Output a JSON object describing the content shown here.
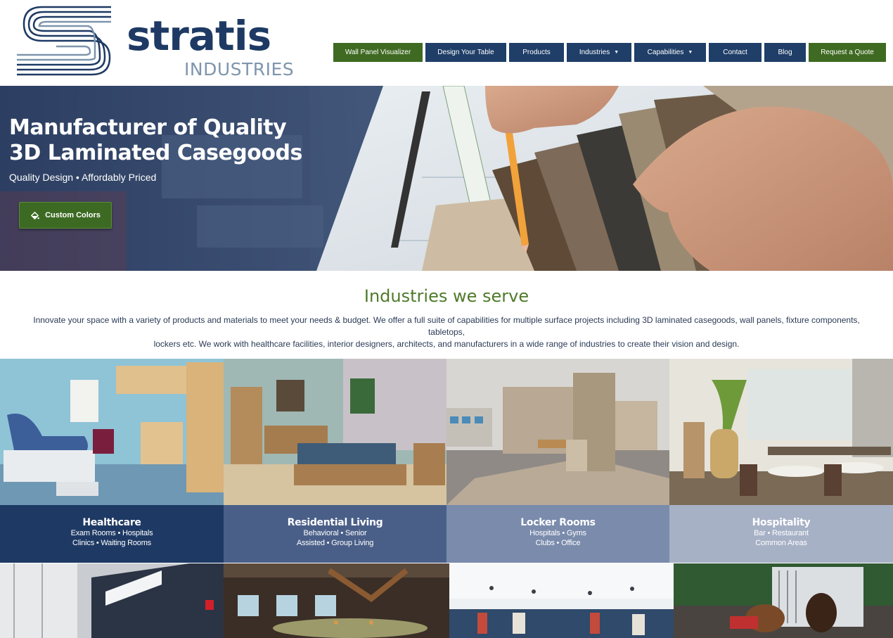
{
  "logo": {
    "word": "stratis",
    "sub": "INDUSTRIES"
  },
  "nav": [
    {
      "label": "Wall Panel Visualizer",
      "name": "nav-wall-panel-visualizer",
      "color": "#3f6a22"
    },
    {
      "label": "Design Your Table",
      "name": "nav-design-your-table",
      "color": "#1f3e68"
    },
    {
      "label": "Products",
      "name": "nav-products",
      "color": "#1f3e68"
    },
    {
      "label": "Industries",
      "name": "nav-industries",
      "color": "#1f3e68",
      "dropdown": true
    },
    {
      "label": "Capabilities",
      "name": "nav-capabilities",
      "color": "#1f3e68",
      "dropdown": true
    },
    {
      "label": "Contact",
      "name": "nav-contact",
      "color": "#1f3e68"
    },
    {
      "label": "Blog",
      "name": "nav-blog",
      "color": "#1f3e68"
    },
    {
      "label": "Request a Quote",
      "name": "nav-request-quote",
      "color": "#3f6a22"
    }
  ],
  "hero": {
    "title_line1": "Manufacturer of Quality",
    "title_line2": "3D Laminated Casegoods",
    "subtitle": "Quality Design • Affordably Priced",
    "button_label": "Custom Colors",
    "button_icon": "paint-bucket-icon"
  },
  "industries": {
    "title": "Industries we serve",
    "intro_line1": "Innovate your space with a variety of products and materials to meet your needs & budget. We offer a full suite of capabilities for multiple surface projects including 3D laminated casegoods, wall panels, fixture components, tabletops,",
    "intro_line2": "lockers etc. We work with healthcare facilities, interior designers, architects, and manufacturers in a wide range of industries to create their vision and design.",
    "tiles": [
      {
        "title": "Healthcare",
        "line1": "Exam Rooms • Hospitals",
        "line2": "Clinics • Waiting Rooms",
        "color": "#1e3a64"
      },
      {
        "title": "Residential Living",
        "line1": "Behavioral • Senior",
        "line2": "Assisted • Group Living",
        "color": "#4a5f88"
      },
      {
        "title": "Locker Rooms",
        "line1": "Hospitals • Gyms",
        "line2": "Clubs • Office",
        "color": "#7a8bac"
      },
      {
        "title": "Hospitality",
        "line1": "Bar • Restaurant",
        "line2": "Common Areas",
        "color": "#a7b1c6"
      }
    ]
  },
  "colors": {
    "navy": "#1e3a64",
    "green": "#3f6a22",
    "heading_green": "#4f7a2a"
  }
}
